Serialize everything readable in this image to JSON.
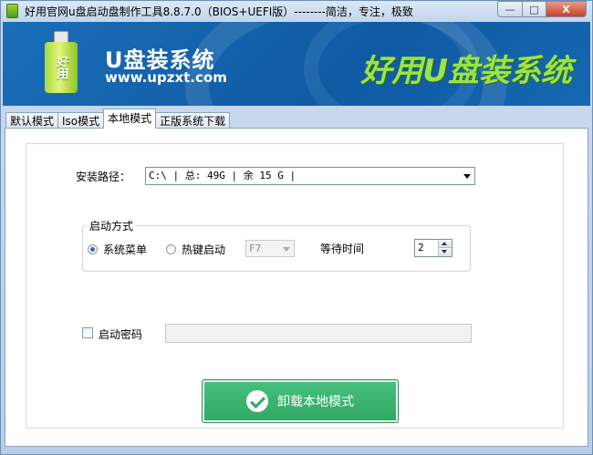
{
  "window": {
    "title": "好用官网u盘启动盘制作工具8.8.7.0（BIOS+UEFI版）--------简洁，专注，极致",
    "min_glyph": "—",
    "max_glyph": "□",
    "close_glyph": "X"
  },
  "banner": {
    "logo_text": "好用",
    "brand_name": "U盘装系统",
    "brand_url": "www.upzxt.com",
    "slogan": "好用U盘装系统"
  },
  "tabs": [
    {
      "label": "默认模式",
      "active": false
    },
    {
      "label": "Iso模式",
      "active": false
    },
    {
      "label": "本地模式",
      "active": true
    },
    {
      "label": "正版系统下载",
      "active": false
    }
  ],
  "install": {
    "path_label": "安装路径：",
    "path_value": "C:\\ | 总: 49G | 余 15 G |"
  },
  "boot": {
    "group_title": "启动方式",
    "option_menu": "系统菜单",
    "option_hotkey": "热键启动",
    "hotkey_value": "F7",
    "wait_label": "等待时间",
    "wait_value": "2",
    "selected": "option_menu"
  },
  "password": {
    "label": "启动密码",
    "checked": false,
    "value": ""
  },
  "action": {
    "uninstall_label": "卸载本地模式"
  },
  "colors": {
    "banner_blue": "#1565b0",
    "slogan_green": "#9be447",
    "button_green": "#34ad68"
  }
}
